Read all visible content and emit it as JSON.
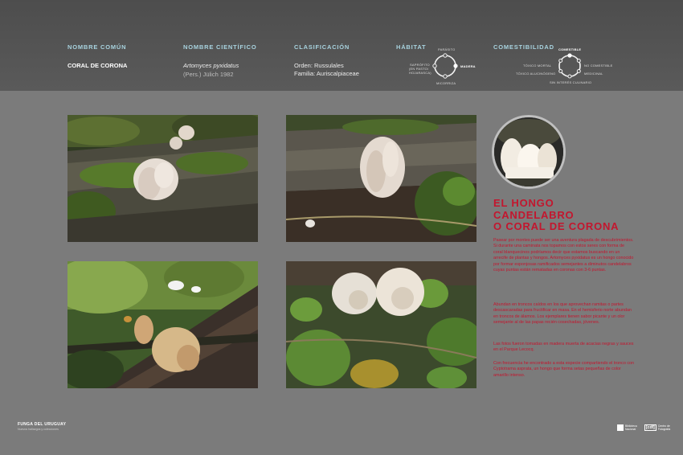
{
  "header": {
    "common_name_label": "NOMBRE COMÚN",
    "common_name": "CORAL DE CORONA",
    "scientific_label": "NOMBRE CIENTÍFICO",
    "scientific_name": "Artomyces pyxidatus",
    "scientific_author": "(Pers.) Jülich 1982",
    "classification_label": "CLASIFICACIÓN",
    "order": "Orden:   Russulales",
    "family": "Familia: Auriscalpiaceae",
    "habitat_label": "HÁBITAT",
    "habitat": {
      "top": "PARÁSITO",
      "right": "MADERA",
      "left1": "SAPRÓFITO",
      "left2": "(EN PASTO/",
      "left3": "HOJARASCA)",
      "bottom": "MICORRIZA",
      "selected": "MADERA"
    },
    "edibility_label": "COMESTIBILIDAD",
    "edibility": {
      "top": "COMESTIBLE",
      "right_top": "NO COMESTIBLE",
      "right_bottom": "MEDICINAL",
      "left_top": "TÓXICO MORTAL",
      "left_bottom": "TÓXICO ALUCINÓGENO",
      "bottom": "SIN INTERÉS CULINARIO",
      "selected": "COMESTIBLE"
    }
  },
  "article": {
    "title_line1": "EL HONGO",
    "title_line2": "CANDELABRO",
    "title_line3": "O CORAL DE CORONA",
    "p1": "Pasear por montes puede ser una aventura plagada de descubrimientos. Si durante una caminata nos topamos con estos seres con forma de coral blanquecinos podríamos decir que estamos buscando en un arrecife de plantas y hongos. Artomyces pyxidatus es un hongo conocido por formar esponjosas ramificados semejantes a diminutos candelabros cuyas puntas están rematadas en coronas con 3-6 puntas.",
    "p2": "Abundan en troncos caídos en los que aprovechan ramitas o partes descascaradas para fructificar en masa. En el hemisferio norte abundan en troncos de álamos. Los ejemplares tienen sabor picante y un olor semejante al de las papas recién cosechadas, jóvenes.",
    "p3": "Las fotos fueron tomadas en madera muerta de acacias negras y sauces en el Parque Lecocq.",
    "p4": "Con frecuencia he encontrado a esta especie compartiendo el tronco con Cyptotrama asprata, un hongo que forma setas pequeñas de color amarillo intenso."
  },
  "footer": {
    "brand": "FUNGA DEL URUGUAY",
    "subtitle": "Nuevos hallazgos y colecciones",
    "logo1_text": "Biblioteca Nacional",
    "logo2_mark": "[cdf]",
    "logo2_text": "Centro de Fotografía"
  },
  "colors": {
    "accent_red": "#c3162e",
    "label_blue": "#a8d3df",
    "header_bg": "#4d4d4d",
    "page_bg": "#7b7b7b"
  }
}
